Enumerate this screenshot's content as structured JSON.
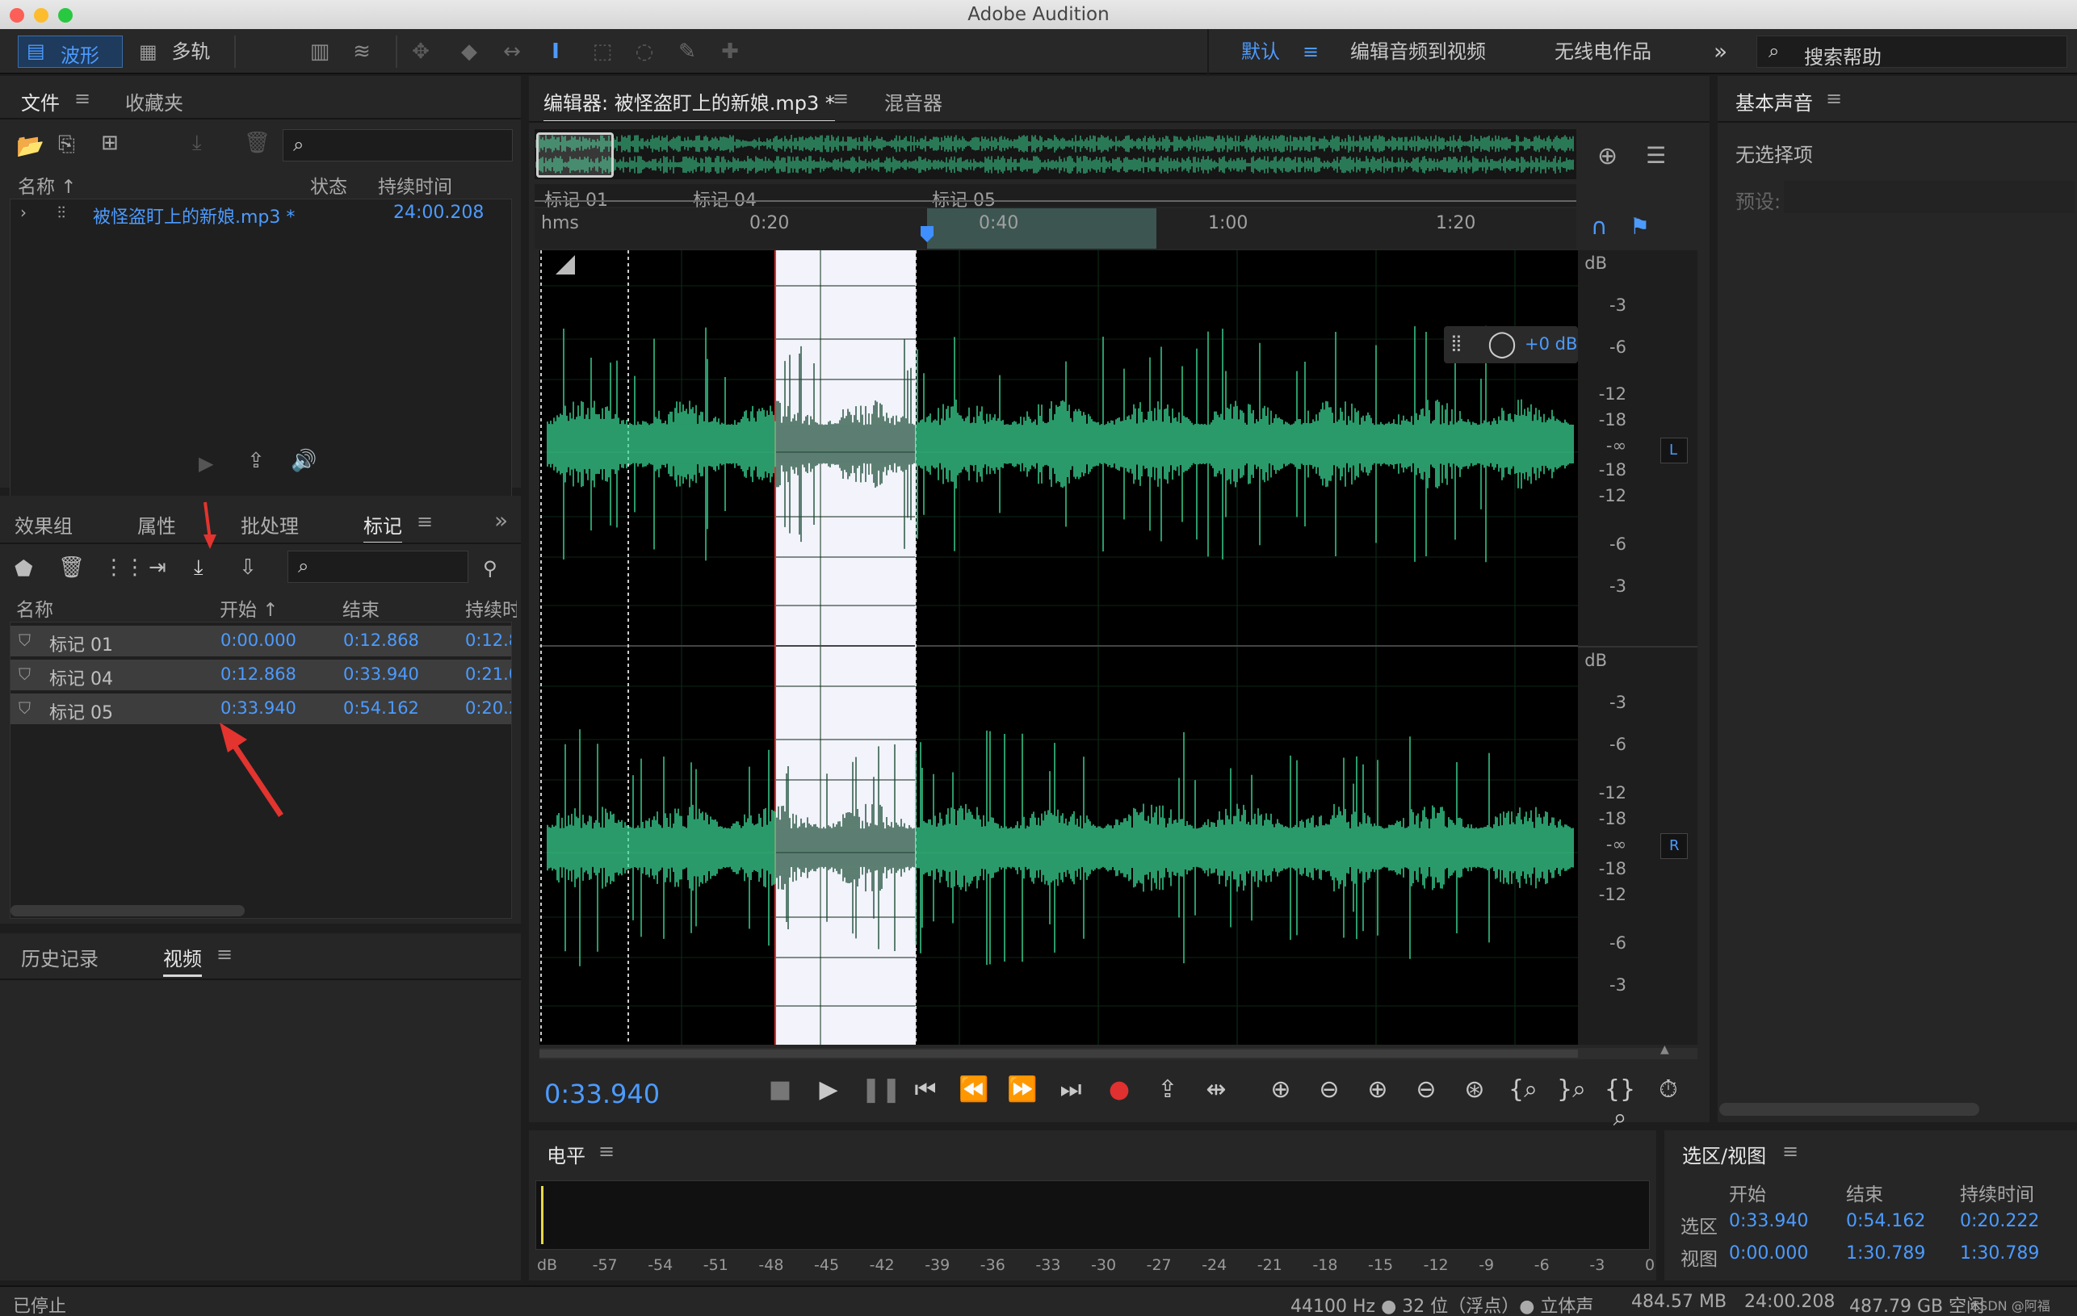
{
  "window": {
    "title": "Adobe Audition"
  },
  "toolbar": {
    "waveform": "波形",
    "multitrack": "多轨",
    "workspace_default": "默认",
    "workspace_edit_video": "编辑音频到视频",
    "workspace_radio": "无线电作品",
    "search_help": "搜索帮助"
  },
  "files": {
    "tab_files": "文件",
    "tab_favorites": "收藏夹",
    "col_name": "名称 ↑",
    "col_status": "状态",
    "col_duration": "持续时间",
    "item_name": "被怪盗盯上的新娘.mp3 *",
    "item_duration": "24:00.208"
  },
  "panel2": {
    "tab_effects": "效果组",
    "tab_properties": "属性",
    "tab_batch": "批处理",
    "tab_markers": "标记"
  },
  "markers": {
    "col_name": "名称",
    "col_start": "开始 ↑",
    "col_end": "结束",
    "col_duration": "持续时",
    "rows": [
      {
        "name": "标记 01",
        "start": "0:00.000",
        "end": "0:12.868",
        "dur": "0:12.8"
      },
      {
        "name": "标记 04",
        "start": "0:12.868",
        "end": "0:33.940",
        "dur": "0:21.0"
      },
      {
        "name": "标记 05",
        "start": "0:33.940",
        "end": "0:54.162",
        "dur": "0:20.2"
      }
    ]
  },
  "bottom_left": {
    "tab_history": "历史记录",
    "tab_video": "视频"
  },
  "editor": {
    "tab_editor": "编辑器: 被怪盗盯上的新娘.mp3 *",
    "tab_mixer": "混音器",
    "time": "0:33.940",
    "marker1": "标记 01",
    "marker2": "标记 04",
    "marker3": "标记 05",
    "hms": "hms",
    "t1": "0:20",
    "t2": "0:40",
    "t3": "1:00",
    "t4": "1:20",
    "gain": "+0 dB",
    "ch_left": "L",
    "ch_right": "R",
    "db_unit": "dB",
    "db_ticks_top": [
      "-3",
      "-6",
      "-12",
      "-18",
      "-∞",
      "-18",
      "-12",
      "-6",
      "-3"
    ],
    "db_ticks_bottom": [
      "-3",
      "-6",
      "-12",
      "-18",
      "-∞",
      "-18",
      "-12",
      "-6",
      "-3"
    ]
  },
  "essential": {
    "title": "基本声音",
    "no_selection": "无选择项",
    "preset": "预设:"
  },
  "levels": {
    "title": "电平",
    "ticks": [
      "dB",
      "-57",
      "-54",
      "-51",
      "-48",
      "-45",
      "-42",
      "-39",
      "-36",
      "-33",
      "-30",
      "-27",
      "-24",
      "-21",
      "-18",
      "-15",
      "-12",
      "-9",
      "-6",
      "-3",
      "0"
    ]
  },
  "selview": {
    "title": "选区/视图",
    "col_start": "开始",
    "col_end": "结束",
    "col_dur": "持续时间",
    "sel_label": "选区",
    "sel_start": "0:33.940",
    "sel_end": "0:54.162",
    "sel_dur": "0:20.222",
    "view_label": "视图",
    "view_start": "0:00.000",
    "view_end": "1:30.789",
    "view_dur": "1:30.789"
  },
  "status": {
    "state": "已停止",
    "format": "44100 Hz ● 32 位（浮点）● 立体声",
    "size": "484.57 MB",
    "duration": "24:00.208",
    "free": "487.79 GB 空闲",
    "watermark": "CSDN @阿福Chris"
  },
  "colors": {
    "accent": "#3f8fff",
    "waveform": "#3ddc97",
    "selection": "#f2f3fb",
    "playhead": "#e03030",
    "annotation": "#e3342f"
  }
}
